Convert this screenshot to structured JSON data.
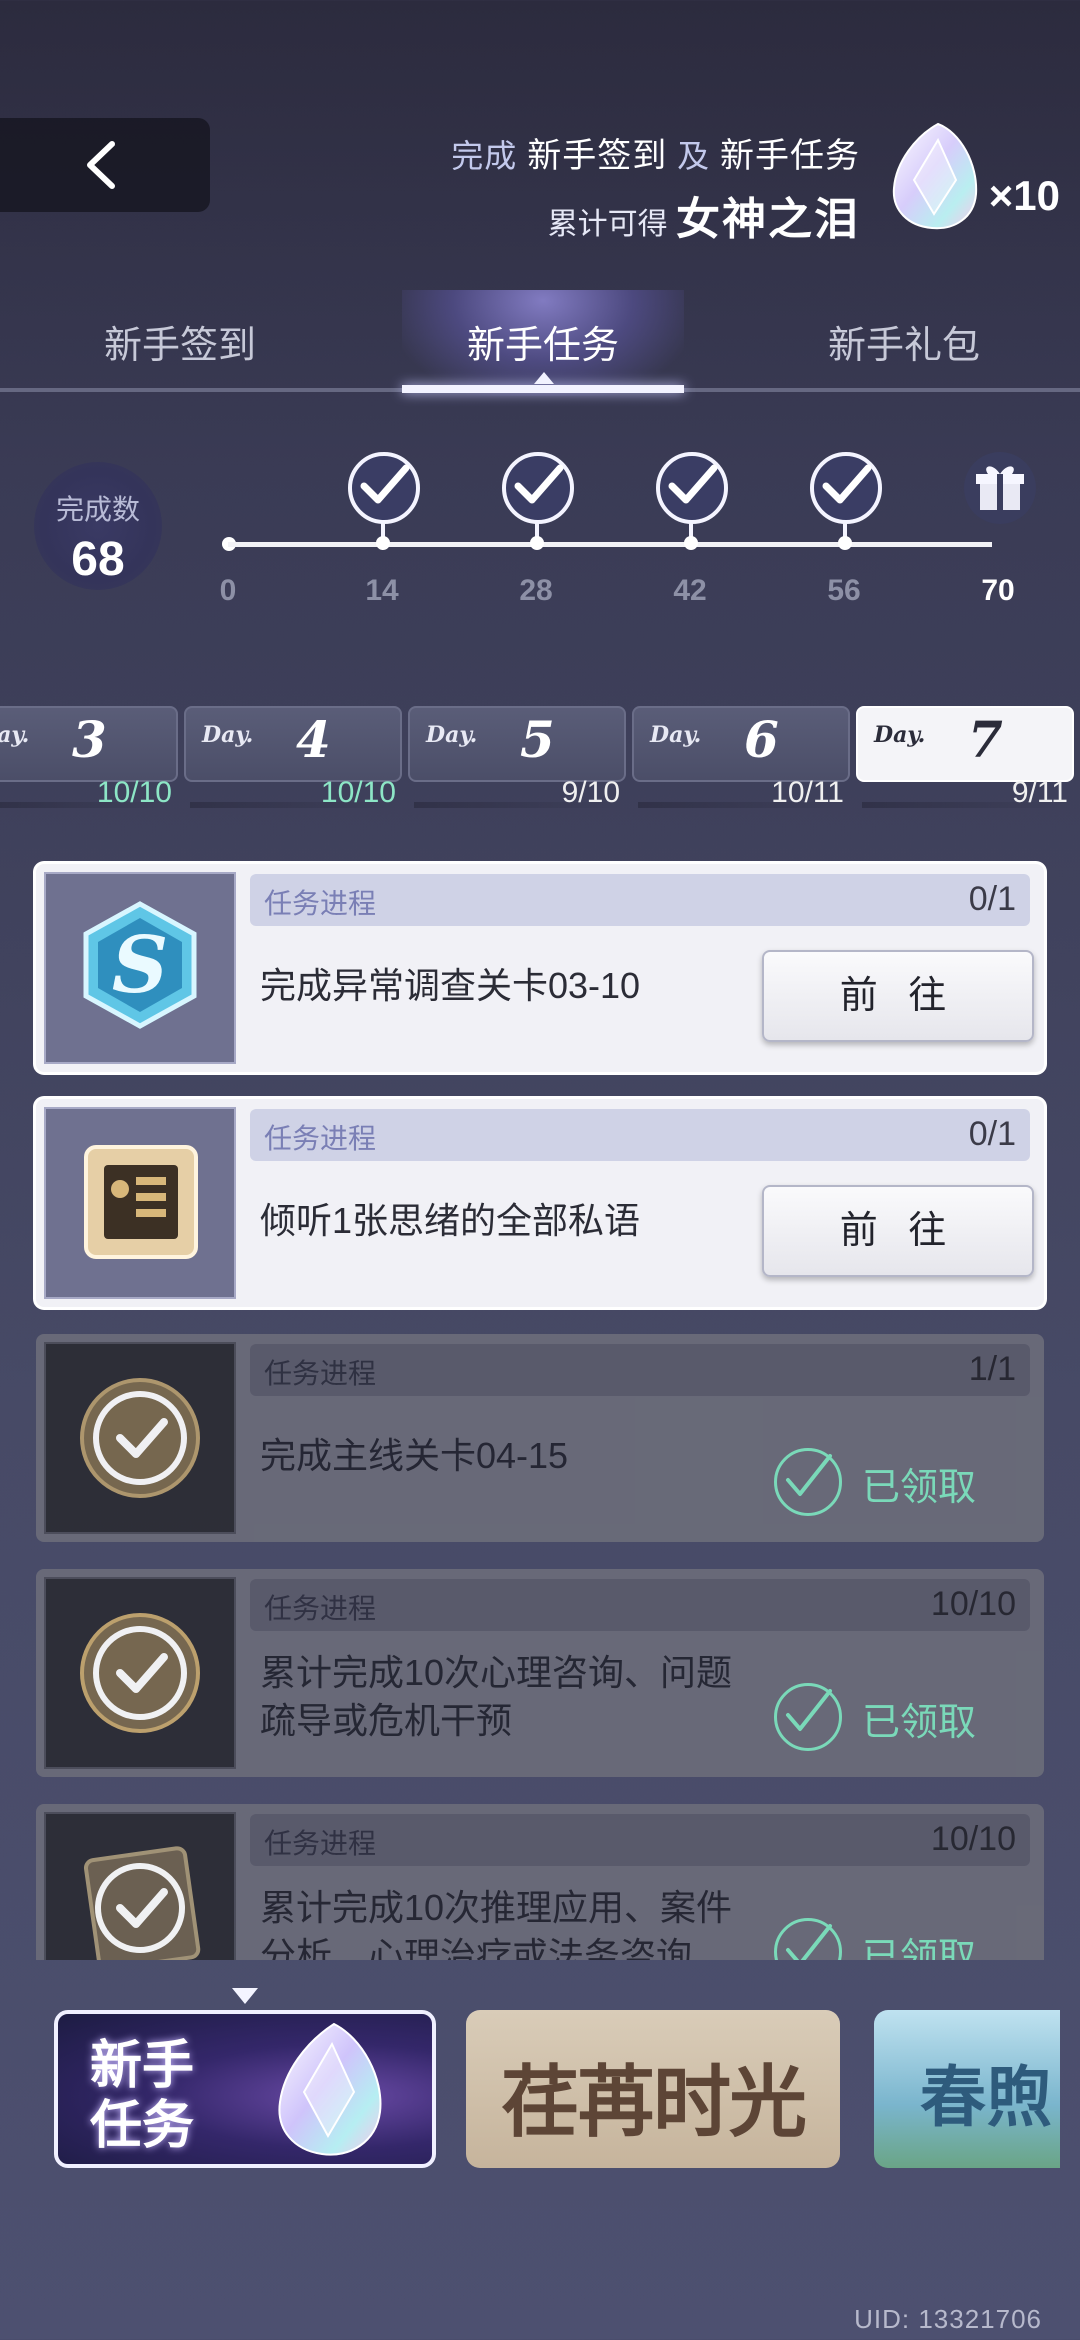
{
  "header": {
    "promo_line1_a": "完成",
    "promo_line1_b": "新手签到",
    "promo_line1_c": "及",
    "promo_line1_d": "新手任务",
    "promo_line2_a": "累计可得",
    "promo_line2_b": "女神之泪",
    "reward_multiplier": "×10"
  },
  "tabs": [
    {
      "label": "新手签到"
    },
    {
      "label": "新手任务"
    },
    {
      "label": "新手礼包"
    }
  ],
  "progress": {
    "count_label": "完成数",
    "count_value": "68",
    "ticks": [
      "0",
      "14",
      "28",
      "42",
      "56",
      "70"
    ]
  },
  "days": [
    {
      "label": "Day.",
      "num": "3",
      "progress": "10/10"
    },
    {
      "label": "Day.",
      "num": "4",
      "progress": "10/10"
    },
    {
      "label": "Day.",
      "num": "5",
      "progress": "9/10"
    },
    {
      "label": "Day.",
      "num": "6",
      "progress": "10/11"
    },
    {
      "label": "Day.",
      "num": "7",
      "progress": "9/11"
    }
  ],
  "tasks": [
    {
      "progress_label": "任务进程",
      "progress": "0/1",
      "title": "完成异常调查关卡03-10",
      "button": "前 往"
    },
    {
      "progress_label": "任务进程",
      "progress": "0/1",
      "title": "倾听1张思绪的全部私语",
      "button": "前 往"
    },
    {
      "progress_label": "任务进程",
      "progress": "1/1",
      "title": "完成主线关卡04-15",
      "status": "已领取"
    },
    {
      "progress_label": "任务进程",
      "progress": "10/10",
      "title_l1": "累计完成10次心理咨询、问题",
      "title_l2": "疏导或危机干预",
      "status": "已领取"
    },
    {
      "progress_label": "任务进程",
      "progress": "10/10",
      "title_l1": "累计完成10次推理应用、案件",
      "title_l2": "分析、心理治疗或法务咨询",
      "status": "已领取"
    }
  ],
  "banners": [
    {
      "line1": "新手",
      "line2": "任务"
    },
    {
      "text": "荏苒时光"
    },
    {
      "text": "春煦"
    }
  ],
  "footer": {
    "uid": "UID: 13321706"
  },
  "colors": {
    "accent_green": "#7fe6c0",
    "tab_active": "#f2f2ff",
    "card_bg": "#f1f1f6"
  }
}
